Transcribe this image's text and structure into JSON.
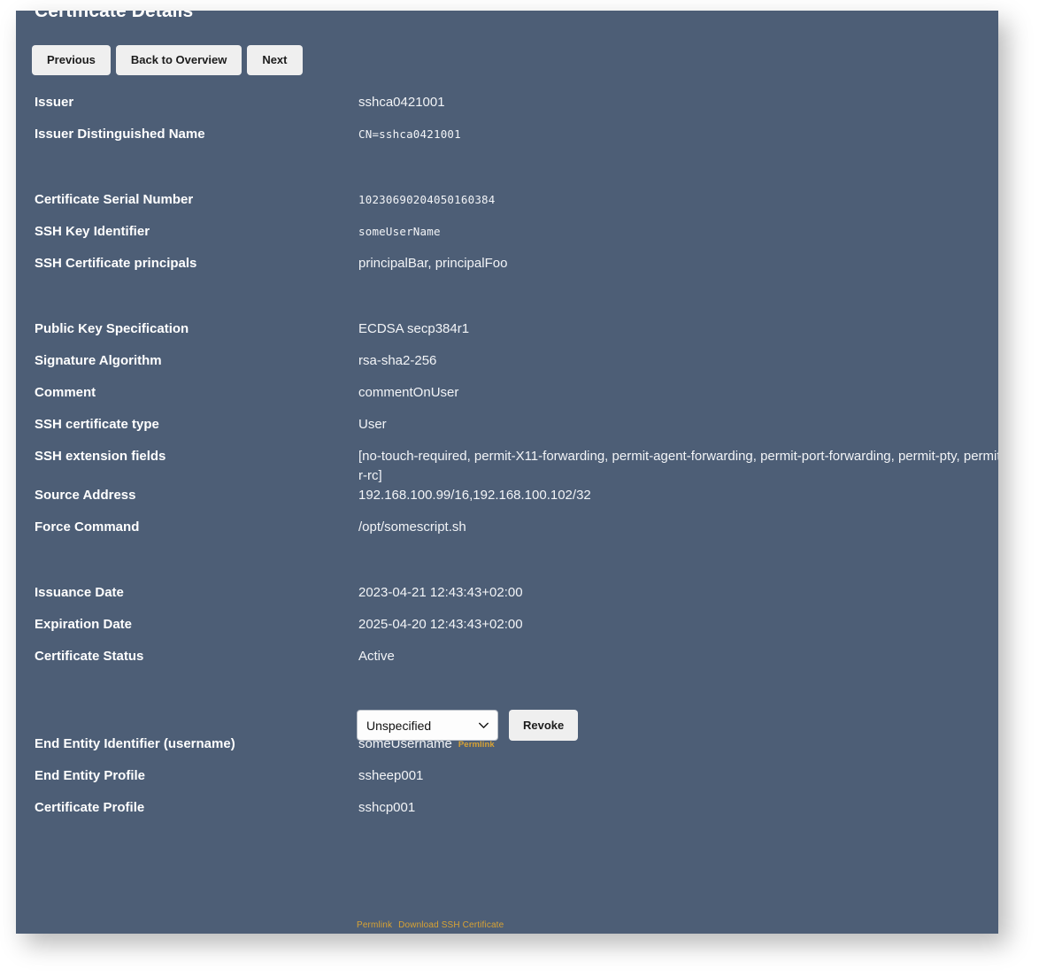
{
  "panel": {
    "title": "Certificate Details",
    "background_color": "#4d5e76",
    "link_color": "#d9a334"
  },
  "toolbar": {
    "previous_label": "Previous",
    "back_label": "Back to Overview",
    "next_label": "Next"
  },
  "details": [
    {
      "label": "Issuer",
      "value": "sshca0421001",
      "style": "text"
    },
    {
      "label": "Issuer Distinguished Name",
      "value": "CN=sshca0421001",
      "style": "mono"
    },
    {
      "label": "",
      "value": "",
      "style": "spacer"
    },
    {
      "label": "Certificate Serial Number",
      "value": "10230690204050160384",
      "style": "mono"
    },
    {
      "label": "SSH Key Identifier",
      "value": "someUserName",
      "style": "mono"
    },
    {
      "label": "SSH Certificate principals",
      "value": "principalBar, principalFoo",
      "style": "text"
    },
    {
      "label": "",
      "value": "",
      "style": "spacer"
    },
    {
      "label": "Public Key Specification",
      "value": "ECDSA secp384r1",
      "style": "text"
    },
    {
      "label": "Signature Algorithm",
      "value": "rsa-sha2-256",
      "style": "text"
    },
    {
      "label": "Comment",
      "value": "commentOnUser",
      "style": "text"
    },
    {
      "label": "SSH certificate type",
      "value": "User",
      "style": "text"
    },
    {
      "label": "SSH extension fields",
      "value": "[no-touch-required, permit-X11-forwarding, permit-agent-forwarding, permit-port-forwarding, permit-pty, permit-user-rc]",
      "style": "wrap"
    },
    {
      "label": "Source Address",
      "value": "192.168.100.99/16,192.168.100.102/32",
      "style": "text"
    },
    {
      "label": "Force Command",
      "value": "/opt/somescript.sh",
      "style": "text"
    },
    {
      "label": "",
      "value": "",
      "style": "spacer"
    },
    {
      "label": "Issuance Date",
      "value": "2023-04-21 12:43:43+02:00",
      "style": "text"
    },
    {
      "label": "Expiration Date",
      "value": "2025-04-20 12:43:43+02:00",
      "style": "text"
    },
    {
      "label": "Certificate Status",
      "value": "Active",
      "style": "text"
    },
    {
      "label": "",
      "value": "",
      "style": "gap-revoke"
    },
    {
      "label": "End Entity Identifier (username)",
      "value": "someUsername",
      "style": "permlink"
    },
    {
      "label": "End Entity Profile",
      "value": "ssheep001",
      "style": "text"
    },
    {
      "label": "Certificate Profile",
      "value": "sshcp001",
      "style": "text"
    }
  ],
  "inline_permlink_label": "Permlink",
  "revoke": {
    "reason_selected": "Unspecified",
    "reason_options": [
      "Unspecified"
    ],
    "button_label": "Revoke"
  },
  "footer": {
    "permlink_label": "Permlink",
    "download_label": "Download SSH Certificate"
  }
}
